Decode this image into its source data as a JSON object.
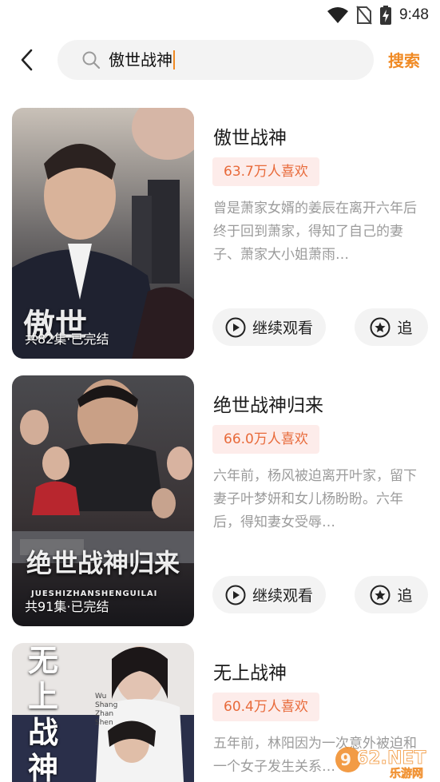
{
  "status_bar": {
    "time": "9:48",
    "icons": [
      "wifi-icon",
      "no-sim-icon",
      "battery-charging-icon"
    ]
  },
  "search": {
    "query": "傲世战神",
    "search_button": "搜索"
  },
  "results": [
    {
      "title": "傲世战神",
      "likes": "63.7万人喜欢",
      "description": "曾是萧家女婿的姜辰在离开六年后终于回到萧家，得知了自己的妻子、萧家大小姐萧雨…",
      "poster_caption": "共82集·已完结",
      "poster_title": "傲世",
      "continue_label": "继续观看",
      "follow_label": "追"
    },
    {
      "title": "绝世战神归来",
      "likes": "66.0万人喜欢",
      "description": "六年前，杨风被迫离开叶家，留下妻子叶梦妍和女儿杨盼盼。六年后，得知妻女受辱…",
      "poster_caption": "共91集·已完结",
      "poster_title": "绝世战神归来",
      "poster_subtitle": "JUESHIZHANSHENGUILAI",
      "continue_label": "继续观看",
      "follow_label": "追"
    },
    {
      "title": "无上战神",
      "likes": "60.4万人喜欢",
      "description": "五年前，林阳因为一次意外被迫和一个女子发生关系…",
      "poster_title": "无上战神",
      "poster_subtitle": "Wu Shang Zhan Shen"
    }
  ],
  "watermark": {
    "text": "962.NET",
    "subtext": "乐游网"
  },
  "colors": {
    "accent": "#f08a24",
    "badge_bg": "#fdecea",
    "badge_text": "#e86a3a"
  }
}
